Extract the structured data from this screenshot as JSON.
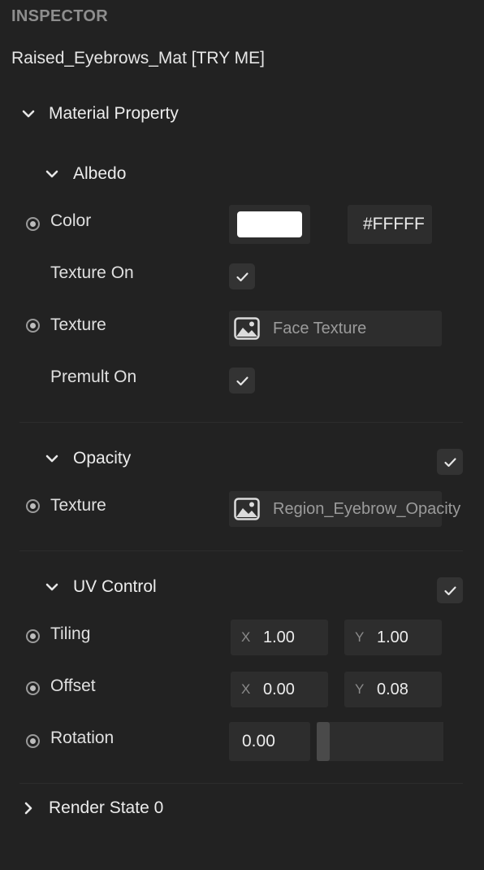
{
  "inspector": {
    "title": "INSPECTOR",
    "material_name": "Raised_Eyebrows_Mat [TRY ME]"
  },
  "material_property": {
    "label": "Material Property",
    "expanded": true
  },
  "albedo": {
    "label": "Albedo",
    "color": {
      "label": "Color",
      "value": "#FFFFFF",
      "hex_text": "#FFFFF"
    },
    "texture_on": {
      "label": "Texture On",
      "checked": true
    },
    "texture": {
      "label": "Texture",
      "name": "Face Texture"
    },
    "premult_on": {
      "label": "Premult On",
      "checked": true
    }
  },
  "opacity": {
    "label": "Opacity",
    "enabled": true,
    "texture": {
      "label": "Texture",
      "name": "Region_Eyebrow_Opacity"
    }
  },
  "uv_control": {
    "label": "UV Control",
    "enabled": true,
    "tiling": {
      "label": "Tiling",
      "x_axis": "X",
      "x": "1.00",
      "y_axis": "Y",
      "y": "1.00"
    },
    "offset": {
      "label": "Offset",
      "x_axis": "X",
      "x": "0.00",
      "y_axis": "Y",
      "y": "0.08"
    },
    "rotation": {
      "label": "Rotation",
      "value": "0.00"
    }
  },
  "render_state": {
    "label": "Render State 0",
    "expanded": false
  },
  "colors": {
    "background": "#222222",
    "field": "#2d2d2d",
    "header_text": "#8e8e8e"
  }
}
